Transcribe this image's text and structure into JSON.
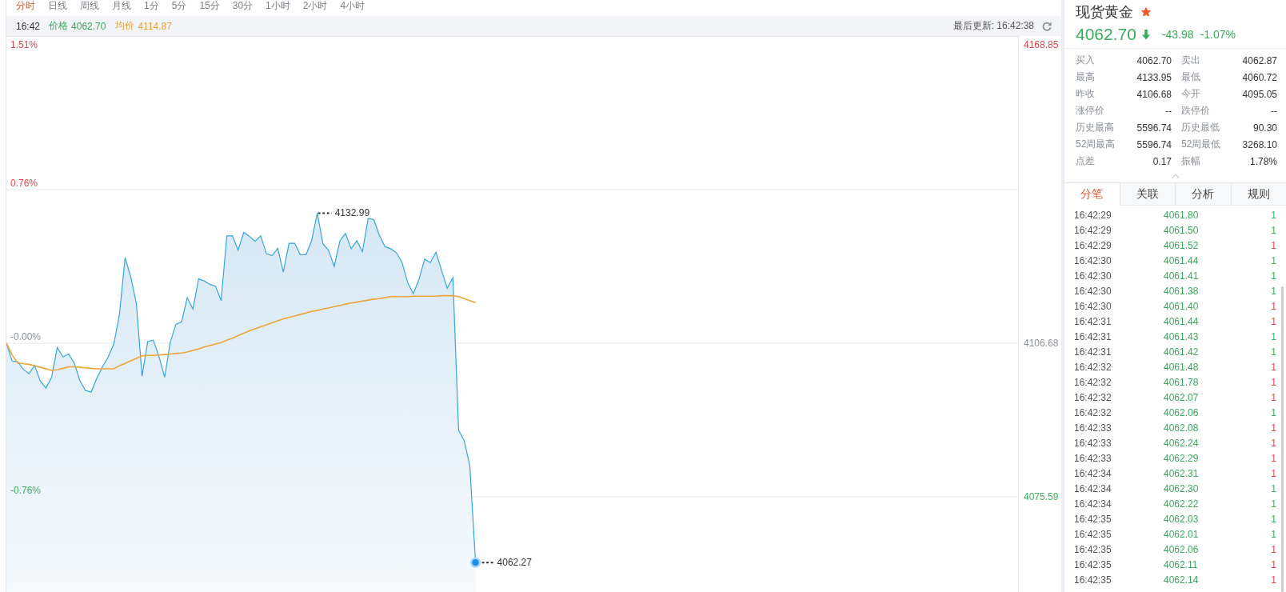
{
  "period_tabs": [
    {
      "label": "分时",
      "selected": true
    },
    {
      "label": "日线",
      "selected": false
    },
    {
      "label": "周线",
      "selected": false
    },
    {
      "label": "月线",
      "selected": false
    },
    {
      "label": "1分",
      "selected": false
    },
    {
      "label": "5分",
      "selected": false
    },
    {
      "label": "15分",
      "selected": false
    },
    {
      "label": "30分",
      "selected": false
    },
    {
      "label": "1小时",
      "selected": false
    },
    {
      "label": "2小时",
      "selected": false
    },
    {
      "label": "4小时",
      "selected": false
    }
  ],
  "info_bar": {
    "time": "16:42",
    "price": "4062.70",
    "average": "4114.87",
    "updated": "最后更新: 16:42:38"
  },
  "chart": {
    "chart_data": {
      "type": "line",
      "ylim": [
        4056.33,
        4168.85
      ],
      "yticks": [
        4168.85,
        4106.68,
        4075.59
      ],
      "categories": [
        null,
        null,
        null,
        null,
        null,
        null,
        null,
        null,
        null,
        null,
        null,
        null,
        null,
        null,
        null,
        null,
        null,
        null,
        null,
        null,
        null,
        null,
        null,
        null,
        null,
        null,
        null,
        null,
        null,
        null,
        null,
        null,
        null,
        null,
        null,
        null,
        null,
        null,
        null,
        null,
        null,
        null,
        null,
        null,
        null,
        null,
        null,
        null,
        null,
        null,
        null,
        null,
        null,
        null,
        null,
        null,
        null,
        null,
        null,
        null,
        null,
        null,
        null,
        null,
        null,
        null,
        null,
        null,
        null,
        null,
        null,
        null,
        null,
        null,
        null,
        null,
        null,
        null,
        null,
        null,
        null,
        null,
        null,
        null,
        null,
        null,
        null,
        null,
        null,
        null,
        null,
        null,
        null,
        null,
        null,
        null,
        null,
        null,
        null,
        null,
        null,
        null,
        null,
        null,
        null,
        null,
        null,
        null,
        null,
        null,
        null,
        null,
        null,
        null,
        null,
        null,
        null,
        null,
        null,
        null,
        null,
        null,
        null,
        null,
        null,
        null,
        null,
        null,
        null,
        null,
        null,
        null,
        null,
        null,
        null,
        null,
        null,
        null,
        null,
        null,
        null,
        null,
        null,
        null,
        null,
        null,
        null,
        null,
        null,
        null,
        null,
        null,
        null,
        null,
        null,
        null,
        null,
        null,
        null,
        null,
        null,
        null,
        null,
        null,
        null,
        null,
        null,
        null,
        null,
        null,
        null,
        null,
        null,
        null,
        null,
        null,
        null,
        null,
        null,
        null
      ],
      "series": [
        {
          "name": "价格",
          "type": "area",
          "color": "#35a5e2",
          "values": [
            4106.7,
            4103.1,
            4102.9,
            4101.4,
            4100.5,
            4102.2,
            4099.0,
            4097.6,
            4099.8,
            4105.8,
            4103.9,
            4104.5,
            4102.7,
            4099.1,
            4097.1,
            4096.8,
            4099.6,
            4101.9,
            4103.9,
            4106.5,
            4112.4,
            4124.0,
            4120.1,
            4114.7,
            4100.0,
            4107.0,
            4107.3,
            4104.0,
            4099.8,
            4106.9,
            4110.5,
            4111.0,
            4115.9,
            4113.6,
            4119.7,
            4119.3,
            4118.6,
            4118.2,
            4115.3,
            4128.4,
            4128.4,
            4125.5,
            4129.1,
            4128.3,
            4127.3,
            4128.4,
            4124.8,
            4124.4,
            4125.9,
            4121.1,
            4126.9,
            4126.9,
            4124.6,
            4124.6,
            4127.4,
            4133.0,
            4126.8,
            4125.5,
            4122.2,
            4127.4,
            4128.9,
            4125.8,
            4127.4,
            4125.2,
            4131.9,
            4131.7,
            4128.5,
            4126.2,
            4125.8,
            4125.0,
            4123.0,
            4118.9,
            4116.7,
            4119.6,
            4123.7,
            4123.0,
            4125.1,
            4121.4,
            4117.8,
            4119.9,
            4089.1,
            4087.0,
            4081.8,
            4062.3,
            null,
            null,
            null,
            null,
            null,
            null,
            null,
            null,
            null,
            null,
            null,
            null,
            null,
            null,
            null,
            null,
            null,
            null,
            null,
            null,
            null,
            null,
            null,
            null,
            null,
            null,
            null,
            null,
            null,
            null,
            null,
            null,
            null,
            null,
            null,
            null,
            null,
            null,
            null,
            null,
            null,
            null,
            null,
            null,
            null,
            null,
            null,
            null,
            null,
            null,
            null,
            null,
            null,
            null,
            null,
            null,
            null,
            null,
            null,
            null,
            null,
            null,
            null,
            null,
            null,
            null,
            null,
            null,
            null,
            null,
            null,
            null,
            null,
            null,
            null,
            null,
            null,
            null,
            null,
            null,
            null,
            null,
            null,
            null,
            null,
            null,
            null,
            null,
            null,
            null,
            null,
            null,
            null,
            null,
            null,
            null
          ]
        },
        {
          "name": "均价",
          "type": "line",
          "color": "#eea437",
          "values": [
            4106.7,
            4104.3,
            4102.7,
            4102.5,
            4102.4,
            4102.1,
            4101.8,
            4101.5,
            4101.2,
            4101.3,
            4101.6,
            4101.9,
            4101.9,
            4101.8,
            4101.7,
            4101.6,
            4101.5,
            4101.5,
            4101.5,
            4101.5,
            4102.1,
            4102.6,
            4103.1,
            4103.6,
            4104.1,
            4104.2,
            4104.2,
            4104.3,
            4104.4,
            4104.5,
            4104.6,
            4104.7,
            4104.9,
            4105.2,
            4105.5,
            4105.9,
            4106.2,
            4106.5,
            4106.8,
            4107.3,
            4107.7,
            4108.2,
            4108.7,
            4109.2,
            4109.6,
            4110.0,
            4110.4,
            4110.8,
            4111.2,
            4111.6,
            4111.9,
            4112.2,
            4112.5,
            4112.8,
            4113.1,
            4113.3,
            4113.6,
            4113.8,
            4114.1,
            4114.3,
            4114.6,
            4114.8,
            4115.0,
            4115.2,
            4115.4,
            4115.6,
            4115.7,
            4115.9,
            4116.1,
            4116.1,
            4116.1,
            4116.1,
            4116.2,
            4116.2,
            4116.2,
            4116.2,
            4116.2,
            4116.3,
            4116.3,
            4116.3,
            4116.1,
            4115.7,
            4115.3,
            4114.9,
            null,
            null,
            null,
            null,
            null,
            null,
            null,
            null,
            null,
            null,
            null,
            null,
            null,
            null,
            null,
            null,
            null,
            null,
            null,
            null,
            null,
            null,
            null,
            null,
            null,
            null,
            null,
            null,
            null,
            null,
            null,
            null,
            null,
            null,
            null,
            null,
            null,
            null,
            null,
            null,
            null,
            null,
            null,
            null,
            null,
            null,
            null,
            null,
            null,
            null,
            null,
            null,
            null,
            null,
            null,
            null,
            null,
            null,
            null,
            null,
            null,
            null,
            null,
            null,
            null,
            null,
            null,
            null,
            null,
            null,
            null,
            null,
            null,
            null,
            null,
            null,
            null,
            null,
            null,
            null,
            null,
            null,
            null,
            null,
            null,
            null,
            null,
            null,
            null,
            null,
            null,
            null,
            null,
            null,
            null,
            null
          ]
        }
      ]
    },
    "percent_labels": [
      {
        "label": "1.51%",
        "color": "#e0474c"
      },
      {
        "label": "0.76%",
        "color": "#e0474c"
      },
      {
        "label": "-0.00%",
        "color": "#8a8f99"
      },
      {
        "label": "-0.76%",
        "color": "#3cb15b"
      }
    ],
    "high_label": "4132.99",
    "last_label": "4062.27"
  },
  "quote": {
    "title": "现货黄金",
    "favorite": true,
    "price": "4062.70",
    "falling": true,
    "change": "-43.98",
    "change_pct": "-1.07%",
    "stats": [
      {
        "label": "买入",
        "value": "4062.70"
      },
      {
        "label": "卖出",
        "value": "4062.87"
      },
      {
        "label": "最高",
        "value": "4133.95"
      },
      {
        "label": "最低",
        "value": "4060.72"
      },
      {
        "label": "昨收",
        "value": "4106.68"
      },
      {
        "label": "今开",
        "value": "4095.05"
      },
      {
        "label": "涨停价",
        "value": "--"
      },
      {
        "label": "跌停价",
        "value": "--"
      },
      {
        "label": "历史最高",
        "value": "5596.74"
      },
      {
        "label": "历史最低",
        "value": "90.30"
      },
      {
        "label": "52周最高",
        "value": "5596.74"
      },
      {
        "label": "52周最低",
        "value": "3268.10"
      },
      {
        "label": "点差",
        "value": "0.17"
      },
      {
        "label": "振幅",
        "value": "1.78%"
      }
    ]
  },
  "detail_tabs": [
    {
      "label": "分笔",
      "selected": true
    },
    {
      "label": "关联",
      "selected": false
    },
    {
      "label": "分析",
      "selected": false
    },
    {
      "label": "规则",
      "selected": false
    }
  ],
  "trades": [
    {
      "time": "16:42:29",
      "price": "4061.80",
      "volume": "1",
      "color": "#3bb05c"
    },
    {
      "time": "16:42:29",
      "price": "4061.50",
      "volume": "1",
      "color": "#3bb05c"
    },
    {
      "time": "16:42:29",
      "price": "4061.52",
      "volume": "1",
      "color": "#e5484d"
    },
    {
      "time": "16:42:30",
      "price": "4061.44",
      "volume": "1",
      "color": "#3bb05c"
    },
    {
      "time": "16:42:30",
      "price": "4061.41",
      "volume": "1",
      "color": "#3bb05c"
    },
    {
      "time": "16:42:30",
      "price": "4061.38",
      "volume": "1",
      "color": "#3bb05c"
    },
    {
      "time": "16:42:30",
      "price": "4061.40",
      "volume": "1",
      "color": "#e5484d"
    },
    {
      "time": "16:42:31",
      "price": "4061.44",
      "volume": "1",
      "color": "#e5484d"
    },
    {
      "time": "16:42:31",
      "price": "4061.43",
      "volume": "1",
      "color": "#3bb05c"
    },
    {
      "time": "16:42:31",
      "price": "4061.42",
      "volume": "1",
      "color": "#3bb05c"
    },
    {
      "time": "16:42:32",
      "price": "4061.48",
      "volume": "1",
      "color": "#e5484d"
    },
    {
      "time": "16:42:32",
      "price": "4061.78",
      "volume": "1",
      "color": "#e5484d"
    },
    {
      "time": "16:42:32",
      "price": "4062.07",
      "volume": "1",
      "color": "#e5484d"
    },
    {
      "time": "16:42:32",
      "price": "4062.06",
      "volume": "1",
      "color": "#3bb05c"
    },
    {
      "time": "16:42:33",
      "price": "4062.08",
      "volume": "1",
      "color": "#e5484d"
    },
    {
      "time": "16:42:33",
      "price": "4062.24",
      "volume": "1",
      "color": "#e5484d"
    },
    {
      "time": "16:42:33",
      "price": "4062.29",
      "volume": "1",
      "color": "#e5484d"
    },
    {
      "time": "16:42:34",
      "price": "4062.31",
      "volume": "1",
      "color": "#e5484d"
    },
    {
      "time": "16:42:34",
      "price": "4062.30",
      "volume": "1",
      "color": "#3bb05c"
    },
    {
      "time": "16:42:34",
      "price": "4062.22",
      "volume": "1",
      "color": "#3bb05c"
    },
    {
      "time": "16:42:35",
      "price": "4062.03",
      "volume": "1",
      "color": "#3bb05c"
    },
    {
      "time": "16:42:35",
      "price": "4062.01",
      "volume": "1",
      "color": "#3bb05c"
    },
    {
      "time": "16:42:35",
      "price": "4062.06",
      "volume": "1",
      "color": "#e5484d"
    },
    {
      "time": "16:42:35",
      "price": "4062.11",
      "volume": "1",
      "color": "#e5484d"
    },
    {
      "time": "16:42:35",
      "price": "4062.14",
      "volume": "1",
      "color": "#e5484d"
    }
  ]
}
